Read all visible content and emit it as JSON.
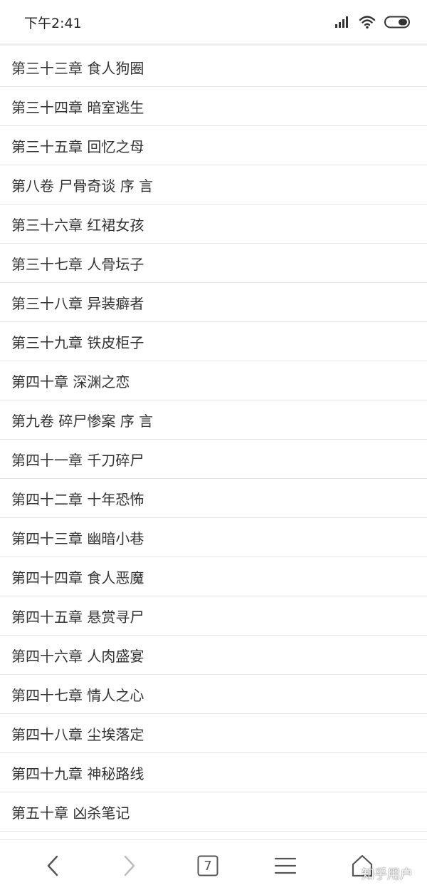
{
  "status_bar": {
    "time": "下午2:41",
    "icons": [
      "signal-icon",
      "wifi-icon",
      "battery-icon"
    ]
  },
  "chapters": [
    "第三十三章 食人狗圈",
    "第三十四章 暗室逃生",
    "第三十五章 回忆之母",
    "第八卷 尸骨奇谈 序 言",
    "第三十六章 红裙女孩",
    "第三十七章 人骨坛子",
    "第三十八章 异装癖者",
    "第三十九章 铁皮柜子",
    "第四十章 深渊之恋",
    "第九卷 碎尸惨案 序 言",
    "第四十一章 千刀碎尸",
    "第四十二章 十年恐怖",
    "第四十三章 幽暗小巷",
    "第四十四章 食人恶魔",
    "第四十五章 悬赏寻尸",
    "第四十六章 人肉盛宴",
    "第四十七章 情人之心",
    "第四十八章 尘埃落定",
    "第四十九章 神秘路线",
    "第五十章 凶杀笔记"
  ],
  "bottom_nav": {
    "tab_count": "7",
    "icons": [
      "back-icon",
      "forward-icon",
      "tabs-icon",
      "menu-icon",
      "home-icon"
    ]
  },
  "watermark": "知乎用户",
  "colors": {
    "text": "#333333",
    "divider": "#e6e6e6",
    "icon": "#555555",
    "disabled_icon": "#bbbbbb"
  }
}
